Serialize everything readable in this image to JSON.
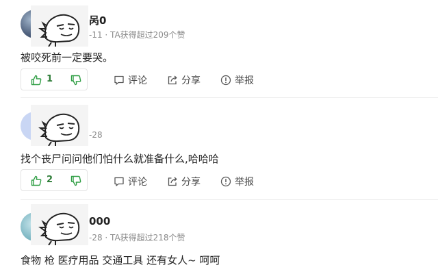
{
  "comments": [
    {
      "name_tail": "呙0",
      "meta": "-11 · TA获得超过209个赞",
      "text": "被咬死前一定要哭。",
      "likes": "1"
    },
    {
      "name_tail": "",
      "meta": "-28",
      "text": "找个丧尸问问他们怕什么就准备什么,哈哈哈",
      "likes": "2"
    },
    {
      "name_tail": "000",
      "meta": "-28 · TA获得超过218个赞",
      "text": "食物 枪 医疗用品 交通工具 还有女人~ 呵呵",
      "likes": ""
    }
  ],
  "actions": {
    "comment_label": "评论",
    "share_label": "分享",
    "report_label": "举报"
  },
  "colors": {
    "accent_green": "#2f9e44",
    "icon_gray": "#555555"
  },
  "icons": [
    "thumbs-up-icon",
    "thumbs-down-icon",
    "comment-icon",
    "share-icon",
    "report-icon",
    "dinosaur-sticker"
  ]
}
